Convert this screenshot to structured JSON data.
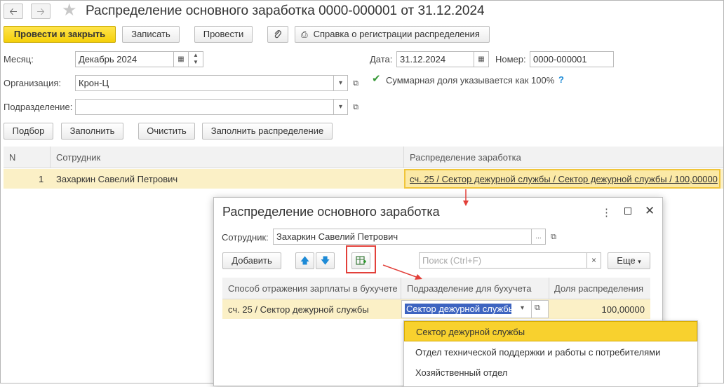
{
  "window": {
    "title": "Распределение основного заработка 0000-000001 от 31.12.2024",
    "back_icon": "arrow-left-icon",
    "forward_icon": "arrow-right-icon",
    "favorite_icon": "star-icon"
  },
  "toolbar": {
    "post_close": "Провести и закрыть",
    "save": "Записать",
    "post": "Провести",
    "reference": "Справка о регистрации распределения"
  },
  "form": {
    "month_label": "Месяц:",
    "month_value": "Декабрь 2024",
    "date_label": "Дата:",
    "date_value": "31.12.2024",
    "number_label": "Номер:",
    "number_value": "0000-000001",
    "org_label": "Организация:",
    "org_value": "Крон-Ц",
    "dept_label": "Подразделение:",
    "dept_value": "",
    "sum_share_label": "Суммарная доля указывается как 100%",
    "sum_share_checked": true,
    "help": "?"
  },
  "actions": {
    "select": "Подбор",
    "fill": "Заполнить",
    "clear": "Очистить",
    "fill_distribution": "Заполнить распределение"
  },
  "table": {
    "headers": [
      "N",
      "Сотрудник",
      "Распределение заработка"
    ],
    "rows": [
      {
        "n": "1",
        "employee": "Захаркин Савелий Петрович",
        "distribution": "сч. 25 / Сектор дежурной службы / Сектор дежурной службы / 100,00000"
      }
    ]
  },
  "dialog": {
    "title": "Распределение основного заработка",
    "employee_label": "Сотрудник:",
    "employee_value": "Захаркин Савелий Петрович",
    "add": "Добавить",
    "search_placeholder": "Поиск (Ctrl+F)",
    "more": "Еще",
    "headers": [
      "Способ отражения зарплаты в бухучете",
      "Подразделение для бухучета",
      "Доля распределения"
    ],
    "row": {
      "method": "сч. 25 / Сектор дежурной службы",
      "department": "Сектор дежурной службы",
      "share": "100,00000"
    },
    "dropdown": [
      "Сектор дежурной службы",
      "Отдел технической поддержки и работы с потребителями",
      "Хозяйственный отдел"
    ]
  },
  "colors": {
    "primary_button": "#f5d009",
    "selected_row": "#fbf0c6",
    "highlight_red": "#e2403a",
    "dropdown_selected": "#f8d12e"
  }
}
